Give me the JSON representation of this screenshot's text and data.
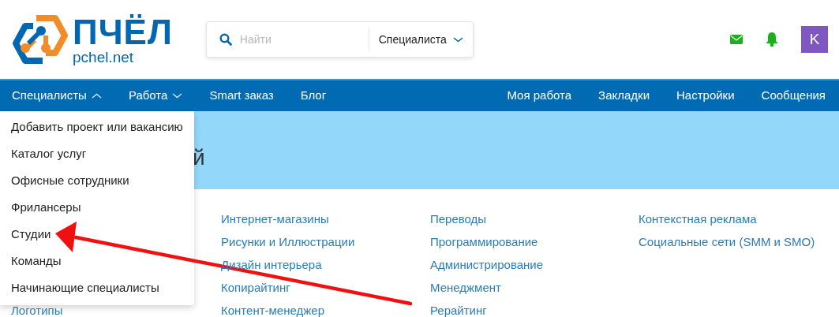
{
  "logo": {
    "name": "ПЧЁЛ",
    "domain": "pchel.net"
  },
  "search": {
    "placeholder": "Найти",
    "scope": "Специалиста"
  },
  "header_icons": {
    "avatar_letter": "K"
  },
  "navbar": {
    "left": [
      {
        "label": "Специалисты",
        "expanded": true
      },
      {
        "label": "Работа",
        "expanded": false
      },
      {
        "label": "Smart заказ"
      },
      {
        "label": "Блог"
      }
    ],
    "right": [
      "Моя работа",
      "Закладки",
      "Настройки",
      "Сообщения"
    ]
  },
  "banner": {
    "title": "й"
  },
  "dropdown": [
    "Добавить проект или вакансию",
    "Каталог услуг",
    "Офисные сотрудники",
    "Фрилансеры",
    "Студии",
    "Команды",
    "Начинающие специалисты"
  ],
  "categories": [
    [
      "Логотипы"
    ],
    [
      "Интернет-магазины",
      "Рисунки и Иллюстрации",
      "Дизайн интерьера",
      "Копирайтинг",
      "Контент-менеджер"
    ],
    [
      "Переводы",
      "Программирование",
      "Администрирование",
      "Менеджмент",
      "Рерайтинг"
    ],
    [
      "Контекстная реклама",
      "Социальные сети (SMM и SMO)"
    ]
  ],
  "annotation": {
    "kind": "arrow"
  }
}
